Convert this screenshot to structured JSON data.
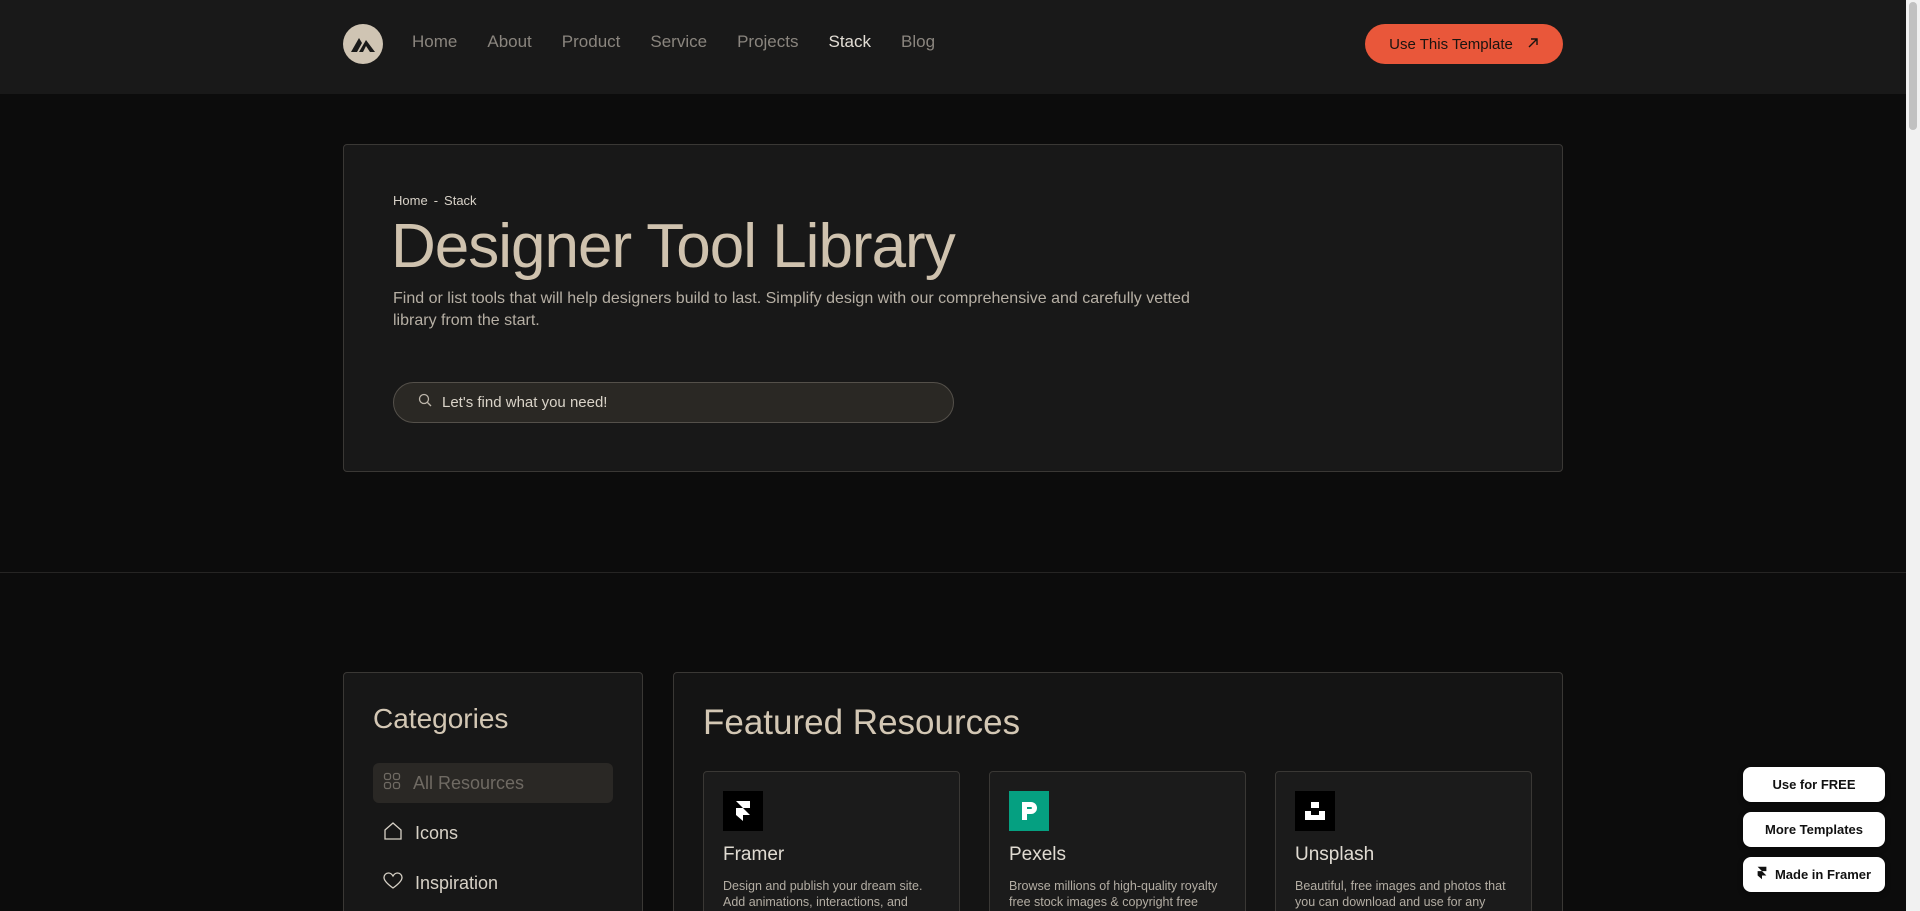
{
  "nav": {
    "links": [
      {
        "label": "Home",
        "active": false
      },
      {
        "label": "About",
        "active": false
      },
      {
        "label": "Product",
        "active": false
      },
      {
        "label": "Service",
        "active": false
      },
      {
        "label": "Projects",
        "active": false
      },
      {
        "label": "Stack",
        "active": true
      },
      {
        "label": "Blog",
        "active": false
      }
    ],
    "cta_label": "Use This Template"
  },
  "hero": {
    "breadcrumb": [
      "Home",
      "-",
      "Stack"
    ],
    "title": "Designer Tool Library",
    "description": "Find or list tools that will help designers build to last. Simplify design with our comprehensive and carefully vetted library from the start.",
    "search_placeholder": "Let's find what you need!"
  },
  "categories": {
    "title": "Categories",
    "items": [
      {
        "label": "All Resources",
        "icon": "grid-icon",
        "active": true
      },
      {
        "label": "Icons",
        "icon": "home-icon",
        "active": false
      },
      {
        "label": "Inspiration",
        "icon": "heart-icon",
        "active": false
      }
    ]
  },
  "featured": {
    "title": "Featured Resources",
    "cards": [
      {
        "name": "Framer",
        "desc": "Design and publish your dream site. Add animations, interactions, and",
        "icon": "framer-logo-icon",
        "icon_bg": "#000000"
      },
      {
        "name": "Pexels",
        "desc": "Browse millions of high-quality royalty free stock images & copyright free",
        "icon": "pexels-logo-icon",
        "icon_bg": "#05a081"
      },
      {
        "name": "Unsplash",
        "desc": "Beautiful, free images and photos that you can download and use for any",
        "icon": "unsplash-logo-icon",
        "icon_bg": "#000000"
      }
    ]
  },
  "floating": {
    "use_free": "Use for FREE",
    "more_templates": "More Templates",
    "made_in_framer": "Made in Framer"
  },
  "colors": {
    "accent": "#e9573a",
    "nav_bg": "#191919",
    "page_bg": "#0c0c0c",
    "title": "#cfc2ae"
  }
}
